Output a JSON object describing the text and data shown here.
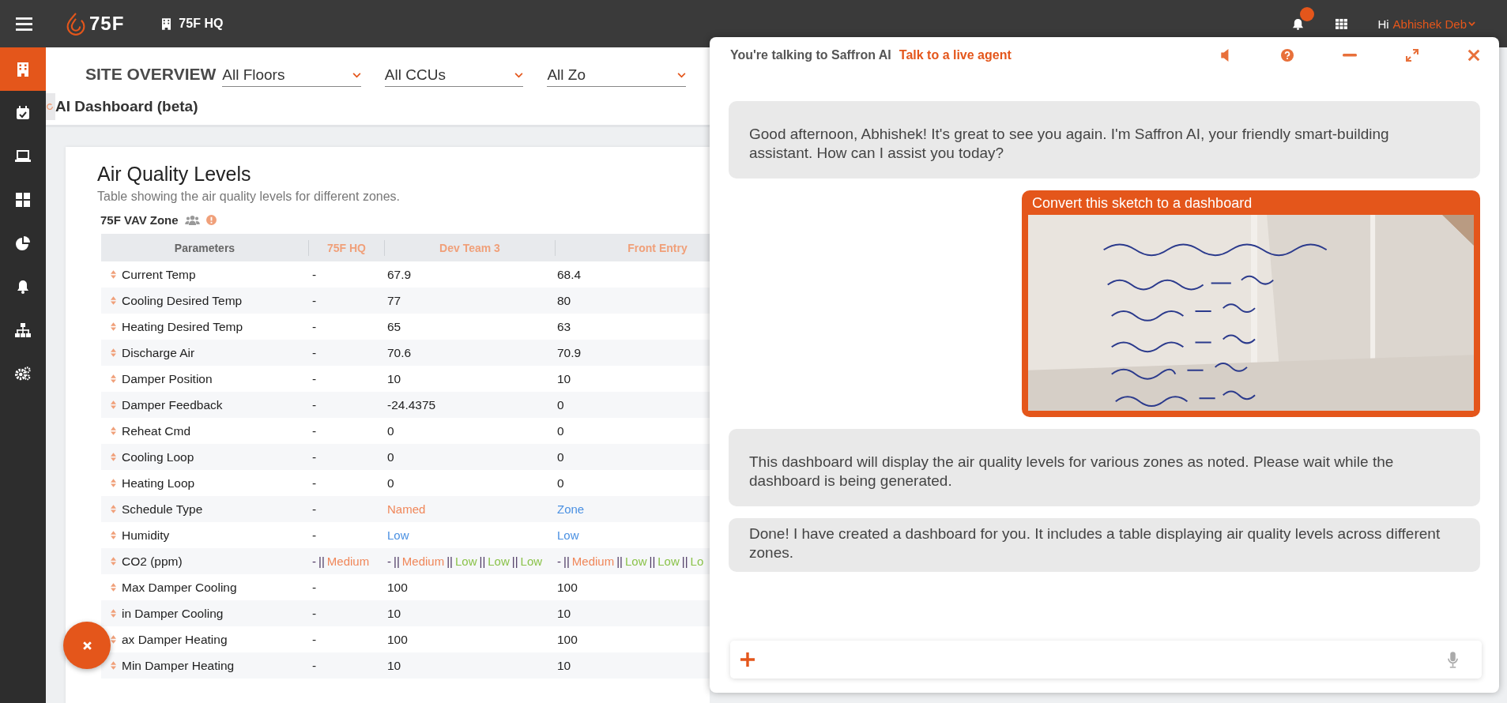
{
  "top_bar": {
    "logo": "75F",
    "site": "75F HQ",
    "greeting": "Hi",
    "user": "Abhishek Deb"
  },
  "sidebar": {
    "items": [
      {
        "kind": "building",
        "selected": true
      },
      {
        "kind": "calendar",
        "selected": false
      },
      {
        "kind": "laptop",
        "selected": false
      },
      {
        "kind": "grid",
        "selected": false
      },
      {
        "kind": "pie",
        "selected": false
      },
      {
        "kind": "bell",
        "selected": false
      },
      {
        "kind": "sitemap",
        "selected": false
      },
      {
        "kind": "cogs",
        "selected": false
      }
    ]
  },
  "header": {
    "title": "SITE OVERVIEW",
    "filters": [
      {
        "value": "All Floors"
      },
      {
        "value": "All CCUs"
      },
      {
        "value": "All Zo"
      }
    ],
    "page_title": "AI Dashboard (beta)"
  },
  "card": {
    "title": "Air Quality Levels",
    "subtitle": "Table showing the air quality levels for different zones.",
    "zone": "75F VAV Zone",
    "table": {
      "columns": [
        {
          "label": "Parameters",
          "kind": "param"
        },
        {
          "label": "75F HQ",
          "kind": "zone"
        },
        {
          "label": "Dev Team 3",
          "kind": "zone"
        },
        {
          "label": "Front Entry",
          "kind": "zone"
        }
      ],
      "rows": [
        {
          "name": "Current Temp",
          "cells": [
            "-",
            "67.9",
            "68.4"
          ]
        },
        {
          "name": "Cooling Desired Temp",
          "cells": [
            "-",
            "77",
            "80"
          ]
        },
        {
          "name": "Heating Desired Temp",
          "cells": [
            "-",
            "65",
            "63"
          ]
        },
        {
          "name": "Discharge Air",
          "cells": [
            "-",
            "70.6",
            "70.9"
          ]
        },
        {
          "name": "Damper Position",
          "cells": [
            "-",
            "10",
            "10"
          ]
        },
        {
          "name": "Damper Feedback",
          "cells": [
            "-",
            "-24.4375",
            "0"
          ]
        },
        {
          "name": "Reheat Cmd",
          "cells": [
            "-",
            "0",
            "0"
          ]
        },
        {
          "name": "Cooling Loop",
          "cells": [
            "-",
            "0",
            "0"
          ]
        },
        {
          "name": "Heating Loop",
          "cells": [
            "-",
            "0",
            "0"
          ]
        },
        {
          "name": "Schedule Type",
          "cells": [
            "-",
            {
              "parts": [
                {
                  "text": "Named",
                  "color": "#f0875a"
                }
              ]
            },
            {
              "parts": [
                {
                  "text": "Zone",
                  "color": "#4a90e2"
                }
              ]
            }
          ]
        },
        {
          "name": "Humidity",
          "cells": [
            "-",
            {
              "parts": [
                {
                  "text": "Low",
                  "color": "#4a90e2"
                }
              ]
            },
            {
              "parts": [
                {
                  "text": "Low",
                  "color": "#4a90e2"
                }
              ]
            }
          ]
        },
        {
          "name": "CO2  (ppm)",
          "cells": [
            {
              "parts": [
                {
                  "text": "-"
                },
                {
                  "text": "||"
                },
                {
                  "text": "Medium",
                  "color": "#f0875a"
                }
              ]
            },
            {
              "parts": [
                {
                  "text": "-"
                },
                {
                  "text": "||"
                },
                {
                  "text": "Medium",
                  "color": "#f0875a"
                },
                {
                  "text": "||"
                },
                {
                  "text": "Low",
                  "color": "#8bc34a"
                },
                {
                  "text": "||"
                },
                {
                  "text": "Low",
                  "color": "#8bc34a"
                },
                {
                  "text": "||"
                },
                {
                  "text": "Low",
                  "color": "#8bc34a"
                }
              ]
            },
            {
              "parts": [
                {
                  "text": "-"
                },
                {
                  "text": "||"
                },
                {
                  "text": "Medium",
                  "color": "#f0875a"
                },
                {
                  "text": "||"
                },
                {
                  "text": "Low",
                  "color": "#8bc34a"
                },
                {
                  "text": "||"
                },
                {
                  "text": "Low",
                  "color": "#8bc34a"
                },
                {
                  "text": "||"
                },
                {
                  "text": "Lo",
                  "color": "#8bc34a"
                }
              ]
            }
          ]
        },
        {
          "name": "Max Damper Cooling",
          "cells": [
            "-",
            "100",
            "100"
          ]
        },
        {
          "name": "in Damper Cooling",
          "cells": [
            "-",
            "10",
            "10"
          ]
        },
        {
          "name": "ax Damper Heating",
          "cells": [
            "-",
            "100",
            "100"
          ]
        },
        {
          "name": "Min Damper Heating",
          "cells": [
            "-",
            "10",
            "10"
          ]
        }
      ]
    }
  },
  "chat": {
    "title": "You're talking to Saffron AI",
    "link": "Talk to a live agent",
    "messages": [
      {
        "kind": "bot",
        "text": "Good afternoon, Abhishek! It's great to see you again. I'm Saffron AI, your friendly smart-building assistant. How can I assist you today?"
      },
      {
        "kind": "user_image",
        "text": "Convert this sketch to a dashboard"
      },
      {
        "kind": "bot",
        "text": "This dashboard will display the air quality levels for various zones as noted. Please wait while the dashboard is being generated."
      },
      {
        "kind": "bot_short",
        "text": "Done! I have created a dashboard for you. It includes a table displaying air quality levels across different zones."
      }
    ]
  }
}
